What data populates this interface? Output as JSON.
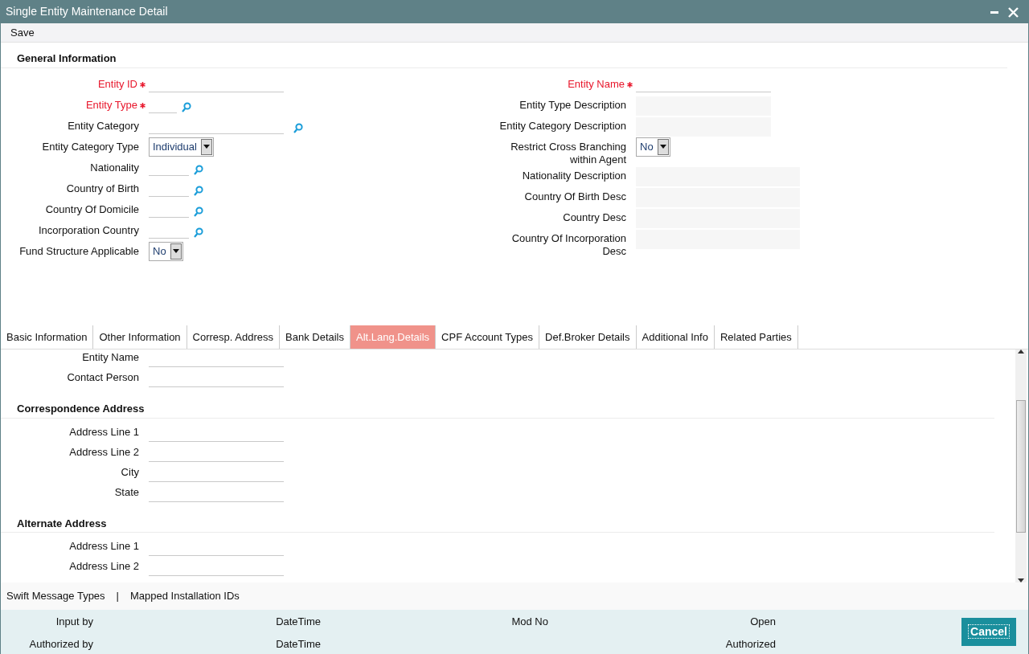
{
  "window": {
    "title": "Single Entity Maintenance Detail"
  },
  "toolbar": {
    "actions": [
      "Save"
    ]
  },
  "general": {
    "heading": "General Information",
    "left_fields": [
      {
        "label": "Entity ID",
        "required": true,
        "kind": "text"
      },
      {
        "label": "Entity Type",
        "required": true,
        "kind": "lookup"
      },
      {
        "label": "Entity Category",
        "required": false,
        "kind": "lookup"
      },
      {
        "label": "Entity Category Type",
        "required": false,
        "kind": "select",
        "value": "Individual"
      },
      {
        "label": "Nationality",
        "required": false,
        "kind": "lookup"
      },
      {
        "label": "Country of Birth",
        "required": false,
        "kind": "lookup"
      },
      {
        "label": "Country Of Domicile",
        "required": false,
        "kind": "lookup"
      },
      {
        "label": "Incorporation Country",
        "required": false,
        "kind": "lookup"
      },
      {
        "label": "Fund Structure Applicable",
        "required": false,
        "kind": "select",
        "value": "No"
      }
    ],
    "right_fields": [
      {
        "label": "Entity Name",
        "required": true,
        "kind": "text"
      },
      {
        "label": "Entity Type Description",
        "required": false,
        "kind": "display"
      },
      {
        "label": "Entity Category Description",
        "required": false,
        "kind": "display"
      },
      {
        "label": "Restrict Cross Branching within Agent",
        "required": false,
        "kind": "select",
        "value": "No"
      },
      {
        "label": "Nationality Description",
        "required": false,
        "kind": "display"
      },
      {
        "label": "Country Of Birth Desc",
        "required": false,
        "kind": "display"
      },
      {
        "label": "Country Desc",
        "required": false,
        "kind": "display"
      },
      {
        "label": "Country Of Incorporation Desc",
        "required": false,
        "kind": "display"
      }
    ]
  },
  "tabs": [
    {
      "label": "Basic Information",
      "selected": false
    },
    {
      "label": "Other Information",
      "selected": false
    },
    {
      "label": "Corresp. Address",
      "selected": false
    },
    {
      "label": "Bank Details",
      "selected": false
    },
    {
      "label": "Alt.Lang.Details",
      "selected": true
    },
    {
      "label": "CPF Account Types",
      "selected": false
    },
    {
      "label": "Def.Broker Details",
      "selected": false
    },
    {
      "label": "Additional Info",
      "selected": false
    },
    {
      "label": "Related Parties",
      "selected": false
    }
  ],
  "tab_panel": {
    "sections": [
      {
        "fields": [
          "Entity Name",
          "Contact Person"
        ]
      },
      {
        "heading": "Correspondence Address",
        "fields": [
          "Address Line 1",
          "Address Line 2",
          "City",
          "State"
        ]
      },
      {
        "heading": "Alternate Address",
        "fields": [
          "Address Line 1",
          "Address Line 2"
        ]
      }
    ]
  },
  "footer_links": {
    "items": [
      "Swift Message Types",
      "Mapped Installation IDs"
    ],
    "separator": "|"
  },
  "audit": {
    "rows": [
      [
        "Input by",
        "DateTime",
        "Mod No",
        "Open"
      ],
      [
        "Authorized by",
        "DateTime",
        "",
        "Authorized"
      ]
    ]
  },
  "cancel_button": "Cancel"
}
